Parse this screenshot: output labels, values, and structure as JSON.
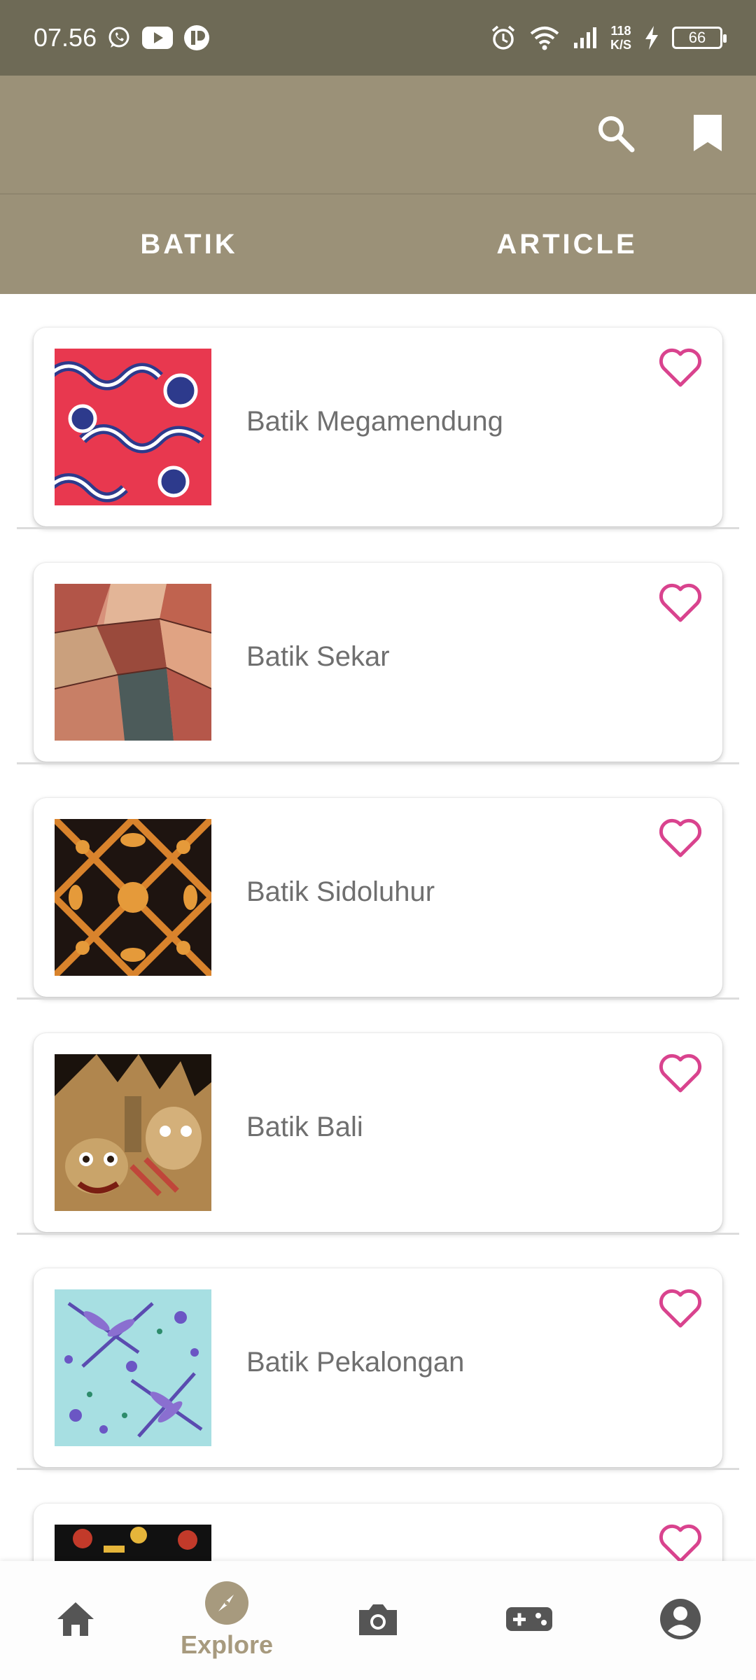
{
  "status_bar": {
    "time": "07.56",
    "net_speed_value": "118",
    "net_speed_unit": "K/S",
    "battery": "66"
  },
  "app_bar": {
    "icons": [
      "search-icon",
      "bookmark-icon"
    ]
  },
  "tabs": [
    {
      "label": "BATIK",
      "selected": true
    },
    {
      "label": "ARTICLE",
      "selected": false
    }
  ],
  "items": [
    {
      "title": "Batik Megamendung",
      "image_icon": "batik-megamendung-image"
    },
    {
      "title": "Batik Sekar",
      "image_icon": "batik-sekar-image"
    },
    {
      "title": "Batik Sidoluhur",
      "image_icon": "batik-sidoluhur-image"
    },
    {
      "title": "Batik Bali",
      "image_icon": "batik-bali-image"
    },
    {
      "title": "Batik Pekalongan",
      "image_icon": "batik-pekalongan-image"
    },
    {
      "title": "",
      "image_icon": "batik-partial-image"
    }
  ],
  "bottom_nav": {
    "items": [
      {
        "icon": "home-icon",
        "label": ""
      },
      {
        "icon": "explore-icon",
        "label": "Explore",
        "active": true
      },
      {
        "icon": "camera-icon",
        "label": ""
      },
      {
        "icon": "gamepad-icon",
        "label": ""
      },
      {
        "icon": "account-icon",
        "label": ""
      }
    ]
  },
  "colors": {
    "status_bar": "#6e6a56",
    "app_bar": "#9b9178",
    "heart": "#d9438e",
    "nav_active": "#a79a7e",
    "nav_icon": "#555555"
  }
}
